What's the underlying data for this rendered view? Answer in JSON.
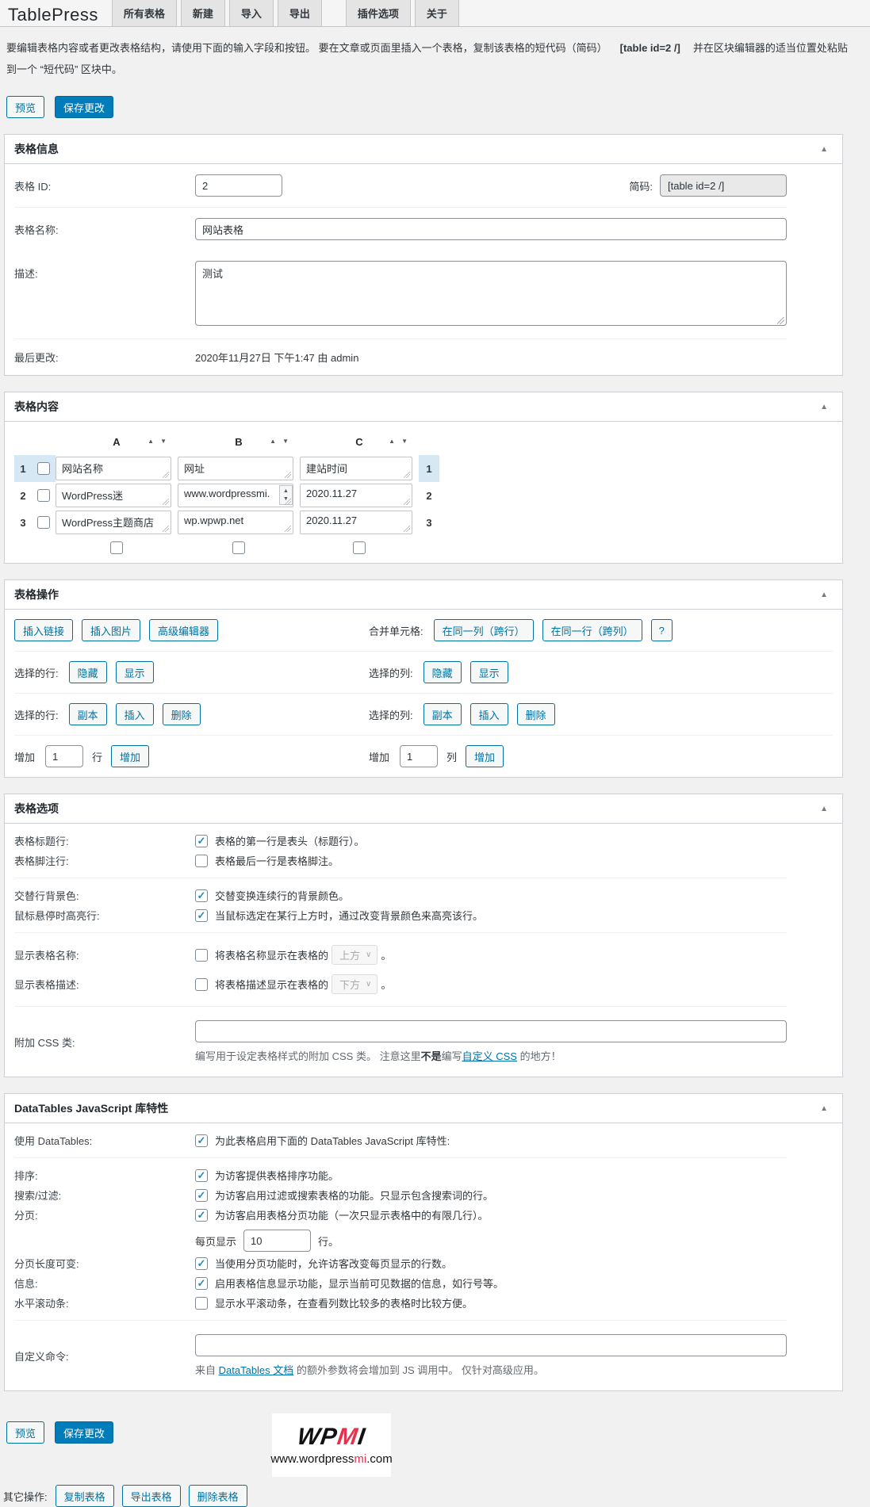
{
  "icons": {
    "collapse": "▲",
    "sort_asc": "▲",
    "sort_desc": "▼",
    "chevron_down": "∨",
    "spinner_up": "▲",
    "spinner_down": "▼"
  },
  "header": {
    "title": "TablePress",
    "tabs": [
      "所有表格",
      "新建",
      "导入",
      "导出",
      "插件选项",
      "关于"
    ]
  },
  "intro": {
    "text_before": "要编辑表格内容或者更改表格结构，请使用下面的输入字段和按钮。 要在文章或页面里插入一个表格，复制该表格的短代码（简码）",
    "shortcode": "[table id=2 /]",
    "text_after": "并在区块编辑器的适当位置处粘贴",
    "line2": "到一个 “短代码” 区块中。"
  },
  "actions_top": {
    "preview": "预览",
    "save": "保存更改"
  },
  "table_info": {
    "title": "表格信息",
    "id_label": "表格 ID:",
    "id_value": "2",
    "shortcode_label": "简码:",
    "shortcode_value": "[table id=2 /]",
    "name_label": "表格名称:",
    "name_value": "网站表格",
    "desc_label": "描述:",
    "desc_value": "测试",
    "modified_label": "最后更改:",
    "modified_value": "2020年11月27日 下午1:47 由 admin"
  },
  "table_content": {
    "title": "表格内容",
    "columns": [
      "A",
      "B",
      "C"
    ],
    "rows": [
      {
        "num": "1",
        "a": "网站名称",
        "b": "网址",
        "c": "建站时间"
      },
      {
        "num": "2",
        "a": "WordPress迷",
        "b": "www.wordpressmi.",
        "c": "2020.11.27"
      },
      {
        "num": "3",
        "a": "WordPress主题商店",
        "b": "wp.wpwp.net",
        "c": "2020.11.27"
      }
    ]
  },
  "table_manipulation": {
    "title": "表格操作",
    "insert_link": "插入链接",
    "insert_image": "插入图片",
    "advanced_editor": "高级编辑器",
    "combine_label": "合并单元格:",
    "combine_rowspan": "在同一列（跨行）",
    "combine_colspan": "在同一行（跨列）",
    "combine_help": "?",
    "selected_rows_label": "选择的行:",
    "selected_cols_label": "选择的列:",
    "hide": "隐藏",
    "show": "显示",
    "duplicate": "副本",
    "insert": "插入",
    "delete": "删除",
    "add_label": "增加",
    "add_rows_value": "1",
    "rows_unit": "行",
    "add_cols_value": "1",
    "cols_unit": "列",
    "add_button": "增加"
  },
  "table_options": {
    "title": "表格选项",
    "header_row": {
      "label": "表格标题行:",
      "checked": true,
      "text": "表格的第一行是表头（标题行）。"
    },
    "footer_row": {
      "label": "表格脚注行:",
      "checked": false,
      "text": "表格最后一行是表格脚注。"
    },
    "alternating": {
      "label": "交替行背景色:",
      "checked": true,
      "text": "交替变换连续行的背景颜色。"
    },
    "hover": {
      "label": "鼠标悬停时高亮行:",
      "checked": true,
      "text": "当鼠标选定在某行上方时，通过改变背景颜色来高亮该行。"
    },
    "show_name": {
      "label": "显示表格名称:",
      "checked": false,
      "text": "将表格名称显示在表格的",
      "select": "上方",
      "suffix": "。"
    },
    "show_desc": {
      "label": "显示表格描述:",
      "checked": false,
      "text": "将表格描述显示在表格的",
      "select": "下方",
      "suffix": "。"
    },
    "css_class": {
      "label": "附加 CSS 类:",
      "value": "",
      "help_pre": "编写用于设定表格样式的附加 CSS 类。 注意这里",
      "help_bold": "不是",
      "help_mid": "编写",
      "help_link": "自定义 CSS",
      "help_post": " 的地方！"
    }
  },
  "datatables": {
    "title": "DataTables JavaScript 库特性",
    "use": {
      "label": "使用 DataTables:",
      "checked": true,
      "text": "为此表格启用下面的 DataTables JavaScript 库特性:"
    },
    "sort": {
      "label": "排序:",
      "checked": true,
      "text": "为访客提供表格排序功能。"
    },
    "filter": {
      "label": "搜索/过滤:",
      "checked": true,
      "text": "为访客启用过滤或搜索表格的功能。只显示包含搜索词的行。"
    },
    "pagination": {
      "label": "分页:",
      "checked": true,
      "text": "为访客启用表格分页功能（一次只显示表格中的有限几行）。",
      "sub_pre": "每页显示",
      "sub_value": "10",
      "sub_post": "行。"
    },
    "length_change": {
      "label": "分页长度可变:",
      "checked": true,
      "text": "当使用分页功能时，允许访客改变每页显示的行数。"
    },
    "info": {
      "label": "信息:",
      "checked": true,
      "text": "启用表格信息显示功能，显示当前可见数据的信息，如行号等。"
    },
    "scrollx": {
      "label": "水平滚动条:",
      "checked": false,
      "text": "显示水平滚动条，在查看列数比较多的表格时比较方便。"
    },
    "custom_commands": {
      "label": "自定义命令:",
      "value": "",
      "help_pre": "来自 ",
      "help_link": "DataTables 文档",
      "help_post": " 的额外参数将会增加到 JS 调用中。 仅针对高级应用。"
    }
  },
  "footer": {
    "preview": "预览",
    "save": "保存更改",
    "logo": {
      "wp": "WP",
      "m": "M",
      "i": "I",
      "url_pre": "www.wordpress",
      "url_mi": "mi",
      "url_post": ".com"
    },
    "other_label": "其它操作:",
    "other_buttons": [
      "复制表格",
      "导出表格",
      "删除表格"
    ]
  }
}
